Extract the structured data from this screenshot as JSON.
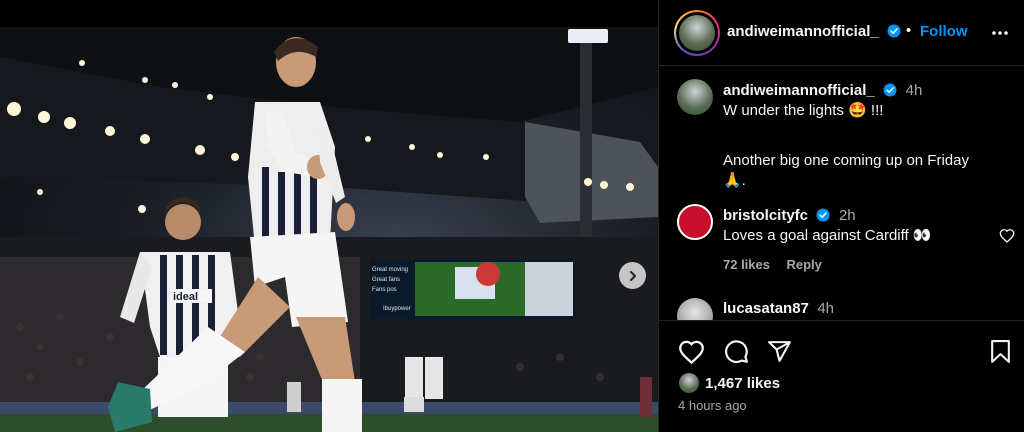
{
  "post": {
    "username": "andiweimannofficial_",
    "follow_label": "Follow",
    "separator": "•",
    "caption": {
      "username": "andiweimannofficial_",
      "time": "4h",
      "line1": "W under the lights 🤩 !!!",
      "line2": "Another big one coming up on Friday",
      "line3": "🙏."
    },
    "comments": [
      {
        "username": "bristolcityfc",
        "time": "2h",
        "text": "Loves a goal against Cardiff 👀",
        "likes": "72 likes",
        "reply": "Reply"
      },
      {
        "username": "lucasatan87",
        "time": "4h"
      }
    ],
    "likes_count": "1,467 likes",
    "posted_ago": "4 hours ago"
  },
  "scoreboard": {
    "lines": [
      "Great moving",
      "Great fans",
      "Fans pos",
      "Ibuypower"
    ]
  },
  "shirt_sponsor": "ideal",
  "colors": {
    "accent": "#0095f6",
    "verified": "#0095f6",
    "bg": "#000000",
    "muted": "#a8a8a8"
  },
  "icons": [
    "verified-icon",
    "more-options-icon",
    "heart-icon",
    "comment-icon",
    "share-icon",
    "bookmark-icon",
    "chevron-right-icon"
  ]
}
